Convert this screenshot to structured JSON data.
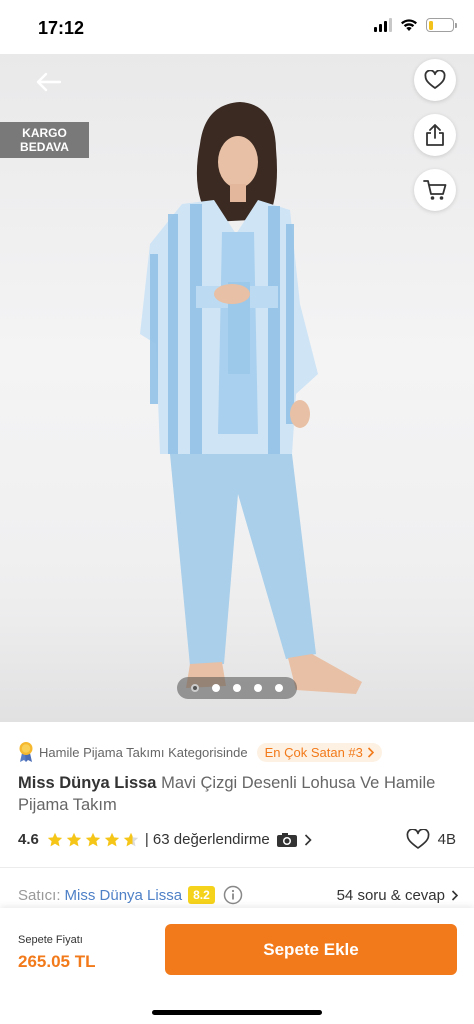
{
  "status_bar": {
    "time": "17:12",
    "battery_level": 0.2
  },
  "hero": {
    "shipping_badge_line1": "KARGO",
    "shipping_badge_line2": "BEDAVA",
    "image_count": 5,
    "active_image_index": 0
  },
  "category": {
    "prefix": "Hamile Pijama Takımı Kategorisinde",
    "best_seller": "En Çok Satan #3"
  },
  "product": {
    "brand": "Miss Dünya Lissa",
    "name": "Mavi Çizgi Desenli Lohusa Ve Hamile Pijama Takım"
  },
  "rating": {
    "value": "4.6",
    "stars": 4.6,
    "reviews_text": "| 63 değerlendirme",
    "favorites": "4B"
  },
  "seller": {
    "label": "Satıcı:",
    "name": "Miss Dünya Lissa",
    "score": "8.2",
    "qa_text": "54 soru & cevap"
  },
  "cart": {
    "price_label": "Sepete Fiyatı",
    "price": "265.05 TL",
    "button_label": "Sepete Ekle"
  },
  "colors": {
    "accent": "#f27a1a",
    "star": "#f5c518",
    "seller_link": "#4f81c7",
    "score_badge": "#f5d21b"
  }
}
